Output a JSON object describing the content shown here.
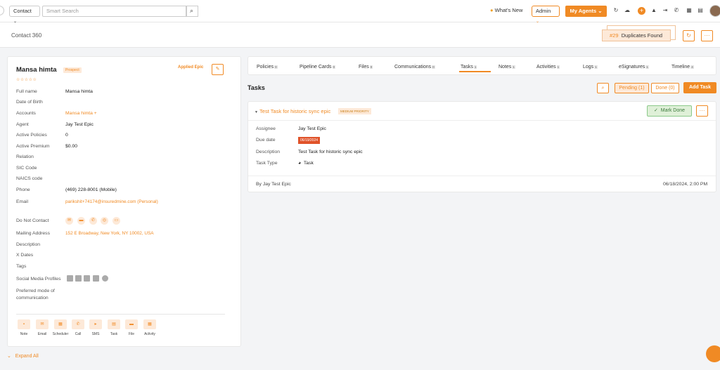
{
  "topbar": {
    "contact_select": "Contact",
    "search_placeholder": "Smart Search",
    "whats_new": "What's New",
    "admin_select": "Admin",
    "my_agents": "My Agents"
  },
  "header": {
    "title": "Contact 360",
    "duplicates_count": "#29",
    "duplicates_label": "Duplicates Found"
  },
  "contact": {
    "name": "Mansa himta",
    "badge": "Prospect",
    "rating": "☆☆☆☆☆",
    "agency_logo": "Applied Epic",
    "fields": [
      {
        "label": "Full name",
        "value": "Mansa himta"
      },
      {
        "label": "Date of Birth",
        "value": ""
      },
      {
        "label": "Accounts",
        "value": "Mansa himta +"
      },
      {
        "label": "Agent",
        "value": "Jay Test Epic"
      },
      {
        "label": "Active Policies",
        "value": "0"
      },
      {
        "label": "Active Premium",
        "value": "$0.00"
      },
      {
        "label": "Relation",
        "value": ""
      },
      {
        "label": "SIC Code",
        "value": ""
      },
      {
        "label": "NAICS code",
        "value": ""
      },
      {
        "label": "Phone",
        "value": "(469) 228-8001 (Mobile)"
      },
      {
        "label": "Email",
        "value": "parikshit+74174@insuredmine.com (Personal)"
      },
      {
        "label": "Do Not Contact",
        "value": ""
      },
      {
        "label": "Mailing Address",
        "value": "152 E Broadway, New York, NY 10002, USA"
      },
      {
        "label": "Description",
        "value": ""
      },
      {
        "label": "X Dates",
        "value": ""
      },
      {
        "label": "Tags",
        "value": ""
      },
      {
        "label": "Social Media Profiles",
        "value": ""
      },
      {
        "label": "Preferred mode of",
        "value": ""
      },
      {
        "label": "communication",
        "value": ""
      }
    ],
    "actions": [
      "Note",
      "Email",
      "Scheduler",
      "Call",
      "SMS",
      "Task",
      "File",
      "Activity"
    ],
    "expand_all": "Expand All"
  },
  "tabs": [
    {
      "label": "Policies",
      "count": "0"
    },
    {
      "label": "Pipeline Cards",
      "count": "0"
    },
    {
      "label": "Files",
      "count": "0"
    },
    {
      "label": "Communications",
      "count": "0"
    },
    {
      "label": "Tasks",
      "count": "1"
    },
    {
      "label": "Notes",
      "count": "1"
    },
    {
      "label": "Activities",
      "count": "1"
    },
    {
      "label": "Logs",
      "count": "1"
    },
    {
      "label": "eSignatures",
      "count": "1"
    },
    {
      "label": "Timeline",
      "count": "4"
    }
  ],
  "tasks": {
    "heading": "Tasks",
    "pending": "Pending (1)",
    "done": "Done (0)",
    "add_task": "Add Task",
    "task": {
      "title": "Test Task for historic sync epic",
      "priority": "MEDIUM PRIORITY",
      "mark_done": "Mark Done",
      "assignee_label": "Assignee",
      "assignee": "Jay Test Epic",
      "due_label": "Due date",
      "due": "06/19/2024",
      "description_label": "Description",
      "description": "Test Task for historic sync epic",
      "type_label": "Task Type",
      "type": "Task",
      "by": "By Jay Test Epic",
      "created": "06/18/2024, 2:00 PM"
    }
  },
  "colors": {
    "accent": "#f08a24",
    "due_badge": "#e0532a",
    "done_green": "#dff0d8"
  }
}
